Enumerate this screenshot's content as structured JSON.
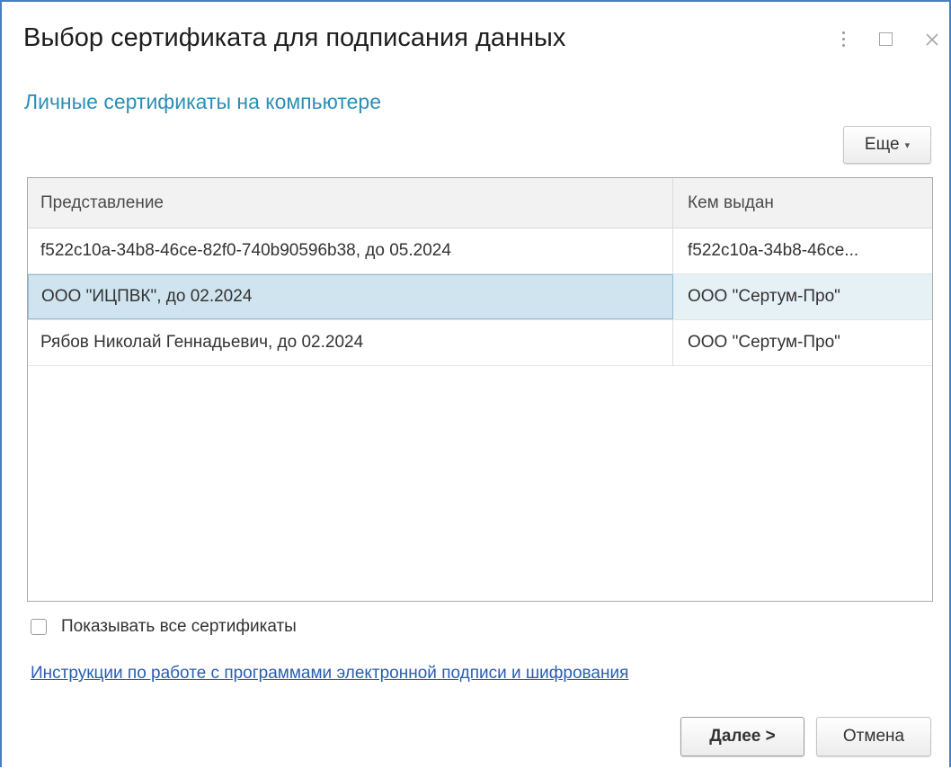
{
  "window": {
    "title": "Выбор сертификата для подписания данных"
  },
  "icons": {
    "more": "more-vertical-icon",
    "maximize": "maximize-icon",
    "close": "close-icon"
  },
  "subtitle": "Личные сертификаты на компьютере",
  "toolbar": {
    "more_label": "Еще",
    "more_caret": "▾"
  },
  "grid": {
    "columns": [
      "Представление",
      "Кем выдан"
    ],
    "rows": [
      {
        "name": "f522c10a-34b8-46ce-82f0-740b90596b38, до 05.2024",
        "issuer": "f522c10a-34b8-46ce..."
      },
      {
        "name": "ООО \"ИЦПВК\", до 02.2024",
        "issuer": "ООО \"Сертум-Про\""
      },
      {
        "name": "Рябов Николай Геннадьевич, до 02.2024",
        "issuer": "ООО \"Сертум-Про\""
      }
    ],
    "selected_row": 1
  },
  "show_all": {
    "label": "Показывать все сертификаты",
    "checked": false
  },
  "instructions_link": "Инструкции по работе с программами электронной подписи и шифрования",
  "buttons": {
    "next": "Далее >",
    "cancel": "Отмена"
  },
  "colors": {
    "accent": "#2c8fb7",
    "link": "#2a5db0",
    "selection": "#cfe4ee",
    "window_border": "#4a7ec4"
  }
}
